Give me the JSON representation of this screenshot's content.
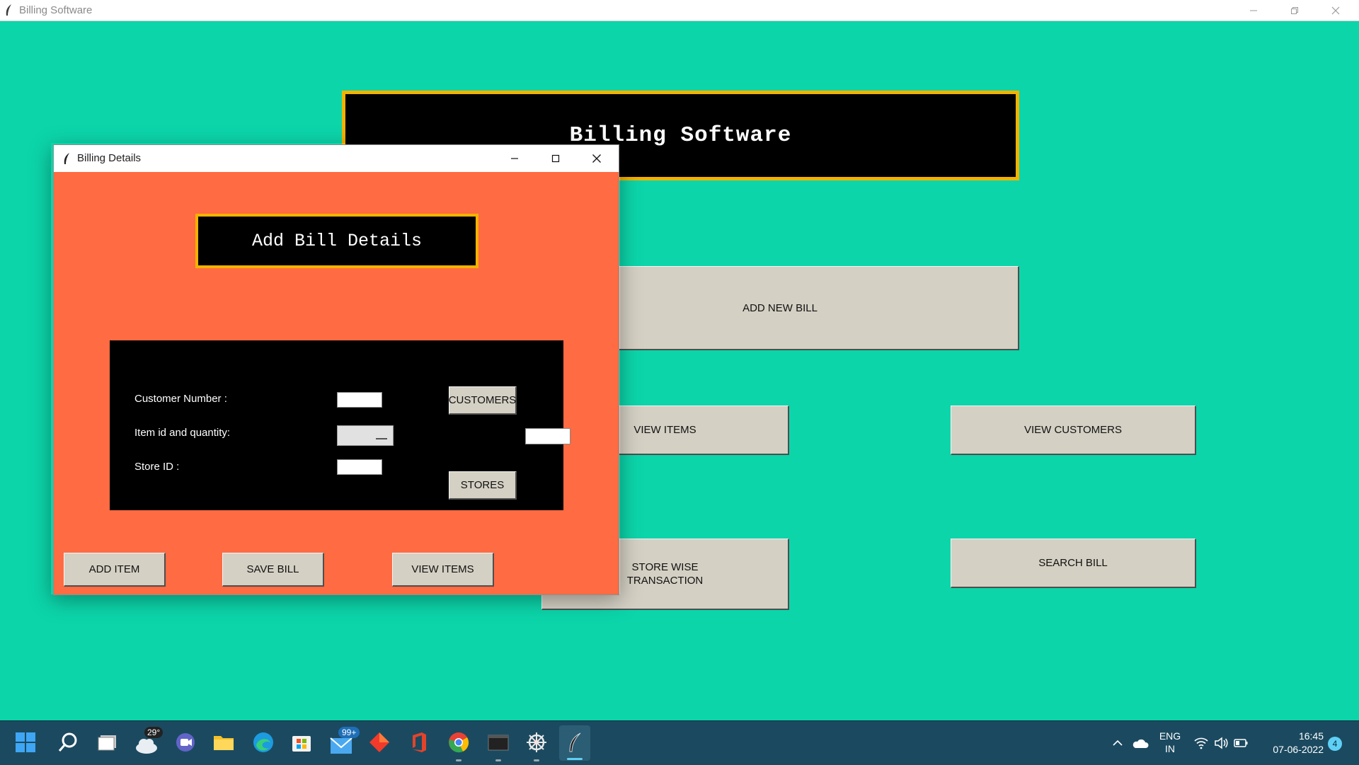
{
  "main_window": {
    "title": "Billing Software",
    "banner": "Billing Software",
    "buttons": {
      "add_new_bill": "ADD NEW BILL",
      "view_items": "VIEW ITEMS",
      "view_customers": "VIEW CUSTOMERS",
      "store_wise_line1": "STORE WISE",
      "store_wise_line2": "TRANSACTION",
      "search_bill": "SEARCH BILL"
    },
    "colors": {
      "background": "#0cd5aa",
      "banner_border": "#f3b200"
    }
  },
  "dialog": {
    "title": "Billing Details",
    "header": "Add Bill Details",
    "labels": {
      "customer_number": "Customer Number :",
      "item_qty": "Item id and quantity:",
      "store_id": "Store ID :"
    },
    "fields": {
      "customer_number": "",
      "item_id": "",
      "quantity": "",
      "store_id": ""
    },
    "panel_buttons": {
      "customers": "CUSTOMERS",
      "stores": "STORES"
    },
    "bottom_buttons": {
      "add_item": "ADD ITEM",
      "save_bill": "SAVE BILL",
      "view_items": "VIEW ITEMS"
    },
    "colors": {
      "background": "#ff6b42"
    }
  },
  "taskbar": {
    "weather_temp": "29°",
    "mail_badge": "99+",
    "language_line1": "ENG",
    "language_line2": "IN",
    "time": "16:45",
    "date": "07-06-2022",
    "notification_count": "4"
  }
}
